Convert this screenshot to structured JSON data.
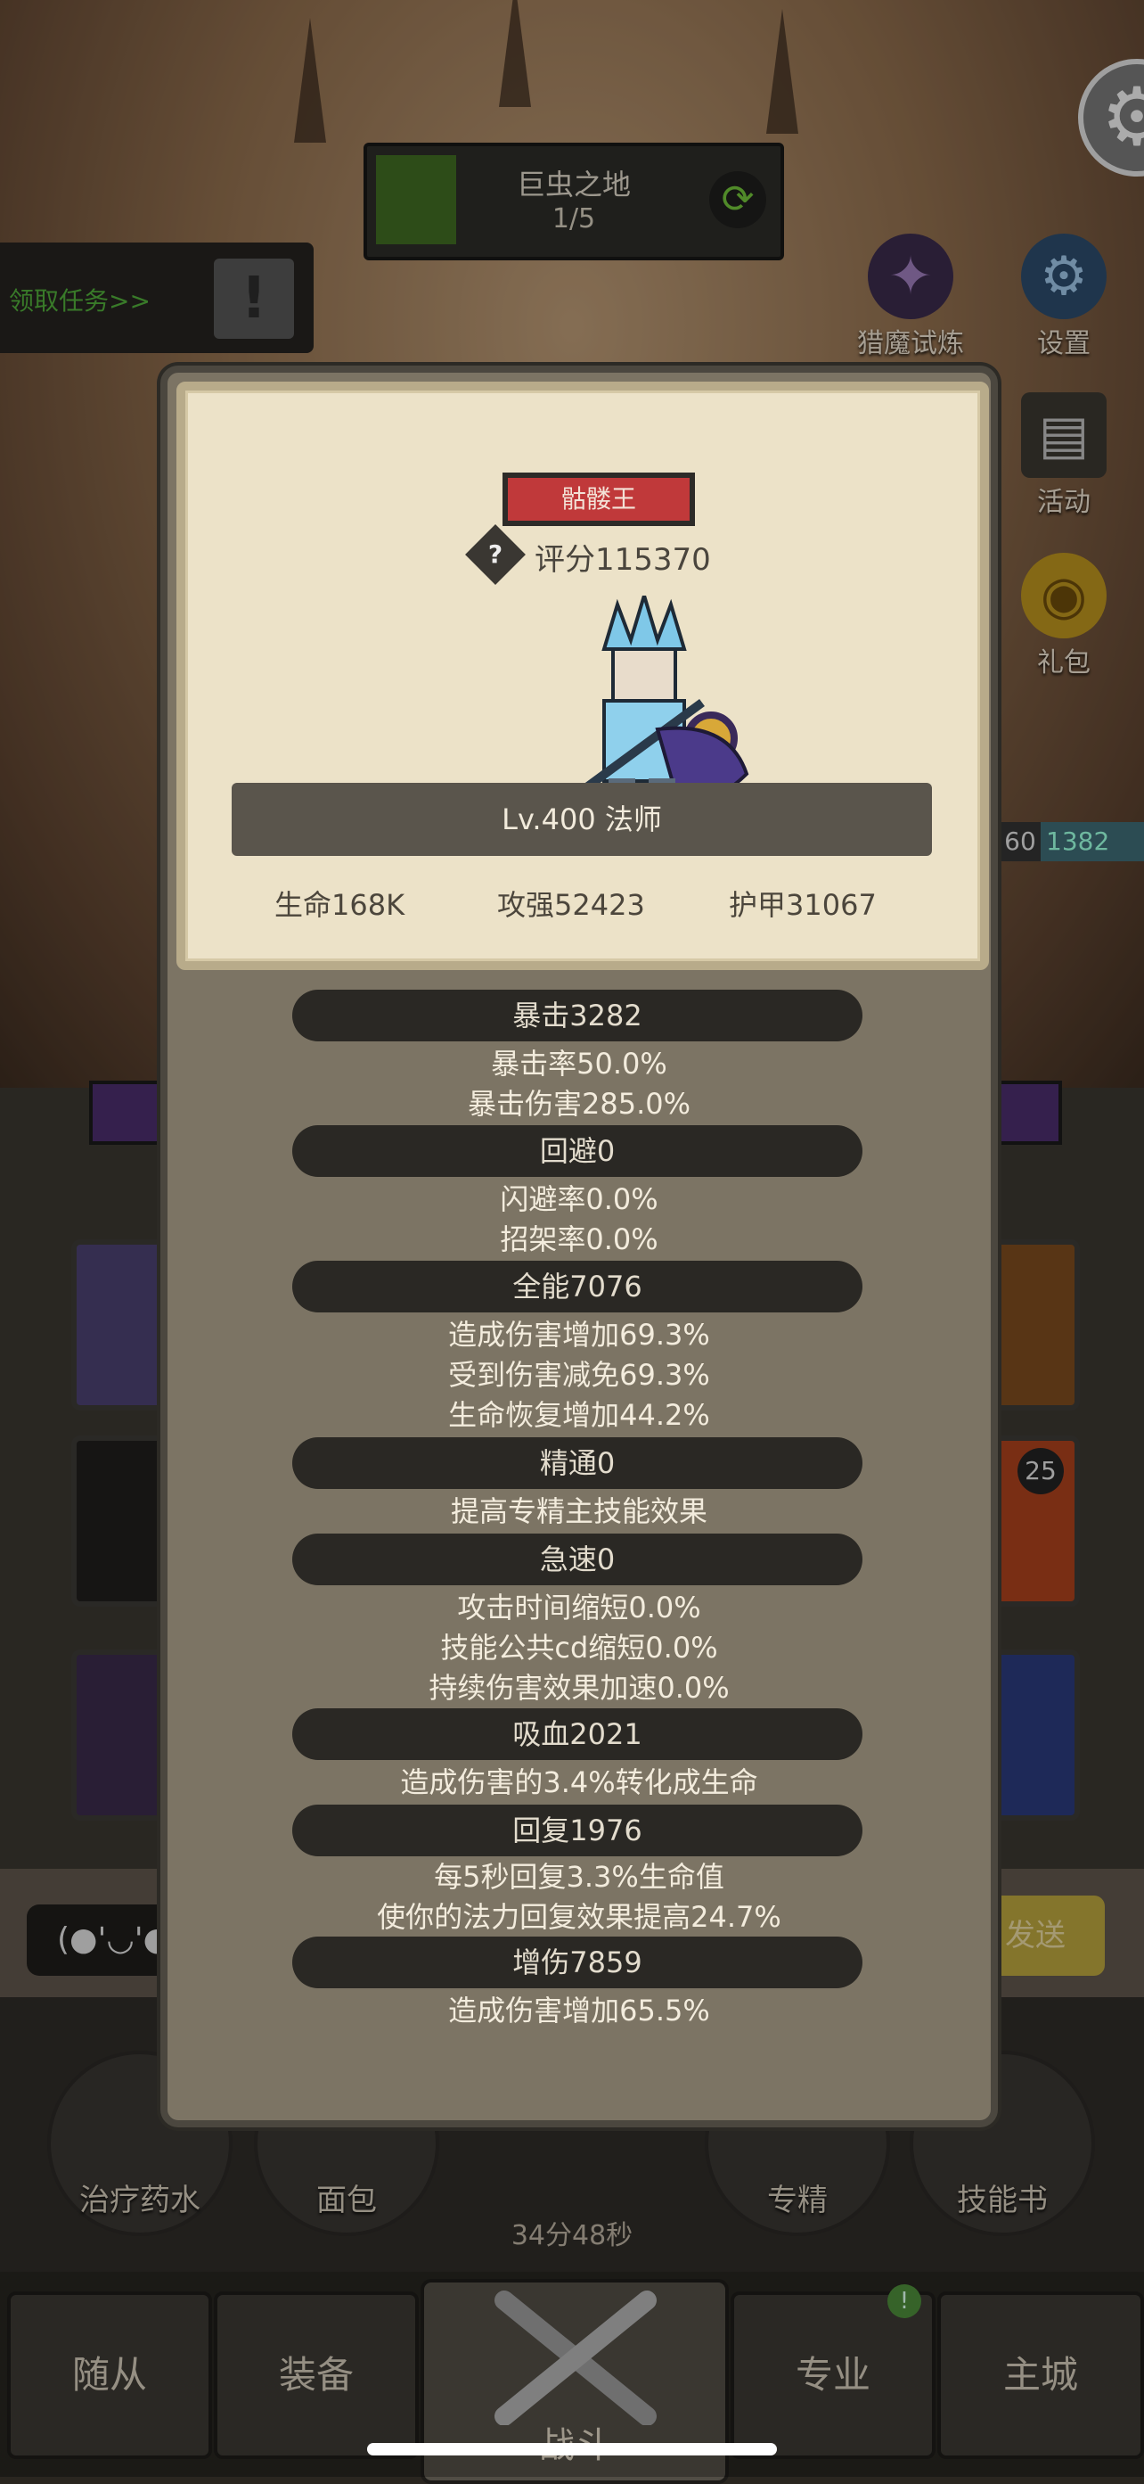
{
  "hud": {
    "zone_title": "巨虫之地",
    "zone_progress": "1/5",
    "quest_label": "领取任务>>",
    "side": {
      "demon_trial": "猎魔试炼",
      "settings": "设置",
      "activity": "活动",
      "gift": "礼包"
    },
    "enemy_level": "60",
    "enemy_hp": "1382"
  },
  "chat": {
    "emoji": "(●'◡'●",
    "send": "发送"
  },
  "items": {
    "potion": "治疗药水",
    "bread": "面包",
    "timer": "34分48秒",
    "mastery": "专精",
    "skillbook": "技能书"
  },
  "nav": {
    "followers": "随从",
    "equipment": "装备",
    "battle": "战斗",
    "profession": "专业",
    "city": "主城",
    "notify": "!",
    "skill_badge": "25"
  },
  "hero": {
    "name": "骷髅王",
    "score": "评分115370",
    "level_class": "Lv.400 法师",
    "hp": "生命168K",
    "attack": "攻强52423",
    "armor": "护甲31067"
  },
  "stats": {
    "crit": {
      "header": "暴击3282",
      "lines": [
        "暴击率50.0%",
        "暴击伤害285.0%"
      ]
    },
    "dodge": {
      "header": "回避0",
      "lines": [
        "闪避率0.0%",
        "招架率0.0%"
      ]
    },
    "versatility": {
      "header": "全能7076",
      "lines": [
        "造成伤害增加69.3%",
        "受到伤害减免69.3%",
        "生命恢复增加44.2%"
      ]
    },
    "mastery": {
      "header": "精通0",
      "lines": [
        "提高专精主技能效果"
      ]
    },
    "haste": {
      "header": "急速0",
      "lines": [
        "攻击时间缩短0.0%",
        "技能公共cd缩短0.0%",
        "持续伤害效果加速0.0%"
      ]
    },
    "lifesteal": {
      "header": "吸血2021",
      "lines": [
        "造成伤害的3.4%转化成生命"
      ]
    },
    "regen": {
      "header": "回复1976",
      "lines": [
        "每5秒回复3.3%生命值",
        "使你的法力回复效果提高24.7%"
      ]
    },
    "dmg_up": {
      "header": "增伤7859",
      "lines": [
        "造成伤害增加65.5%"
      ]
    }
  }
}
